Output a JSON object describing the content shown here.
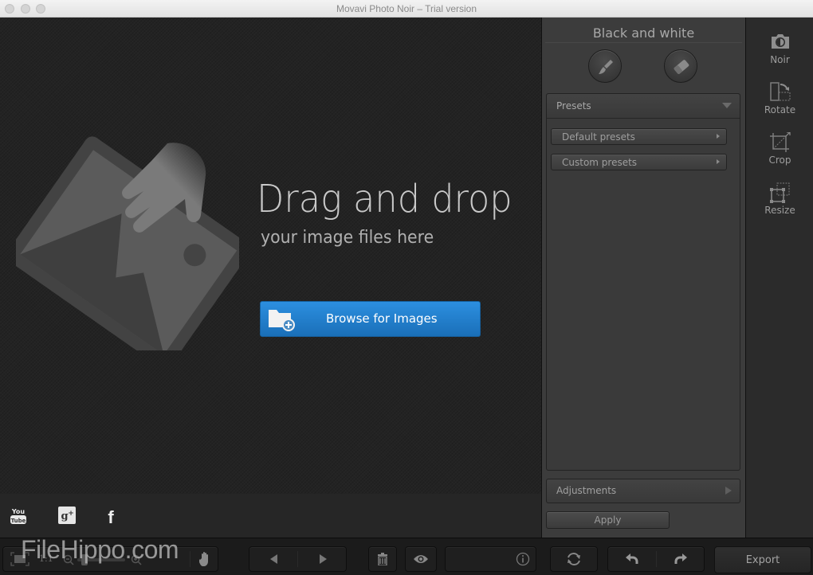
{
  "window": {
    "title": "Movavi Photo Noir – Trial version"
  },
  "canvas": {
    "headline": "Drag and drop",
    "subline": "your image files here",
    "browse_label": "Browse for Images",
    "icons": {
      "illustration": "drag-image-hand-icon",
      "browse": "folder-add-icon"
    }
  },
  "social": [
    {
      "name": "youtube",
      "icon": "youtube-icon"
    },
    {
      "name": "google-plus",
      "icon": "google-plus-icon"
    },
    {
      "name": "facebook",
      "icon": "facebook-icon"
    }
  ],
  "right_panel": {
    "title": "Black and white",
    "brush_icon": "brush-icon",
    "eraser_icon": "eraser-icon",
    "presets": {
      "label": "Presets",
      "items": [
        {
          "label": "Default presets"
        },
        {
          "label": "Custom presets"
        }
      ]
    },
    "adjustments_label": "Adjustments",
    "apply_label": "Apply"
  },
  "tools": [
    {
      "label": "Noir",
      "icon": "camera-icon"
    },
    {
      "label": "Rotate",
      "icon": "rotate-icon"
    },
    {
      "label": "Crop",
      "icon": "crop-icon"
    },
    {
      "label": "Resize",
      "icon": "resize-icon"
    }
  ],
  "bottombar": {
    "zoom_ratio": "1:1",
    "zoom_level": 0.1,
    "export_label": "Export",
    "watermark": "FileHippo.com"
  },
  "colors": {
    "accent": "#1f7ccc",
    "panel": "#3c3c3c",
    "canvas": "#232323"
  }
}
